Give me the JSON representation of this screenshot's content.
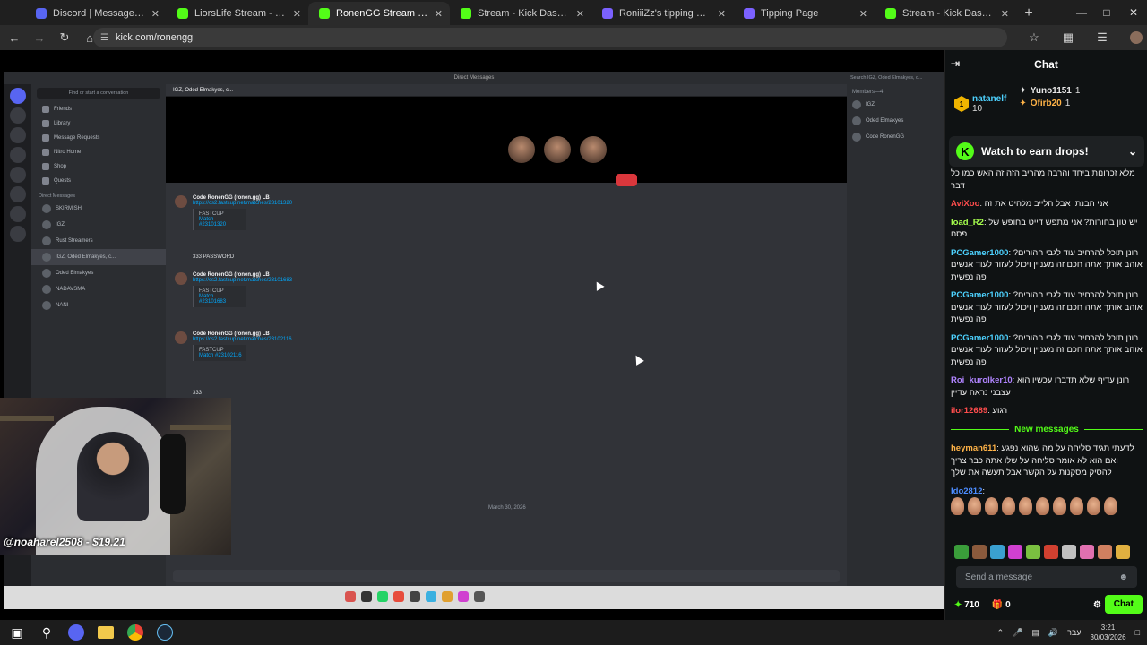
{
  "browser": {
    "tabs": [
      {
        "title": "Discord | Message Requests",
        "favicon_color": "#5865f2",
        "active": false
      },
      {
        "title": "LiorsLife Stream - Watch Live o",
        "favicon_color": "#53fc18",
        "active": false
      },
      {
        "title": "RonenGG Stream - Watch L",
        "favicon_color": "#53fc18",
        "active": true
      },
      {
        "title": "Stream - Kick Dashboard",
        "favicon_color": "#53fc18",
        "active": false
      },
      {
        "title": "RoniiiZz's tipping page",
        "favicon_color": "#7b61ff",
        "active": false
      },
      {
        "title": "Tipping Page",
        "favicon_color": "#7b61ff",
        "active": false
      },
      {
        "title": "Stream - Kick Dashboard",
        "favicon_color": "#53fc18",
        "active": false
      }
    ],
    "url": "kick.com/ronengg"
  },
  "stream": {
    "discord": {
      "title": "Direct Messages",
      "find_placeholder": "Find or start a conversation",
      "nav": [
        "Friends",
        "Library",
        "Message Requests",
        "Nitro Home",
        "Shop",
        "Quests"
      ],
      "dm_header": "Direct Messages",
      "dms": [
        "SKIRMISH",
        "IGZ",
        "Rust Streamers",
        "IGZ, Oded Elmakyes, c...",
        "Oded Elmakyes",
        "NADAVSMA",
        "NANI"
      ],
      "channel_title": "IGZ, Oded Elmakyes, c...",
      "search_placeholder": "Search IGZ, Oded Elmakyes, c...",
      "messages": [
        {
          "author": "Code RonenGG (ronen.gg) LB",
          "link": "https://cs2.fastcup.net/matches/23101320",
          "card_title": "FASTCUP",
          "card_link": "Match #23101320"
        },
        {
          "author": "",
          "text": "333 PASSWORD"
        },
        {
          "author": "Code RonenGG (ronen.gg) LB",
          "link": "https://cs2.fastcup.net/matches/23101683",
          "card_title": "FASTCUP",
          "card_link": "Match #23101683"
        },
        {
          "author": "Code RonenGG (ronen.gg) LB",
          "link": "https://cs2.fastcup.net/matches/23102116",
          "card_title": "FASTCUP",
          "card_link": "Match #23102116"
        },
        {
          "author": "",
          "text": "333"
        }
      ],
      "date_divider": "March 30, 2026",
      "members_label": "Members—4",
      "members": [
        "IGZ",
        "Oded Elmakyes",
        "Code RonenGG"
      ]
    },
    "donation_overlay": "@noaharel2508 - $19.21"
  },
  "chat": {
    "title": "Chat",
    "gifters": [
      {
        "name": "natanelf",
        "count": "10",
        "rank": "1"
      },
      {
        "name": "Yuno1151",
        "count": "1"
      },
      {
        "name": "Ofirb20",
        "count": "1"
      }
    ],
    "drops_label": "Watch to earn drops!",
    "messages": [
      {
        "user": "",
        "color": "#ffffff",
        "text": "מלא זכרונות ביחד והרבה מהריב הזה זה האש כמו כל דבר"
      },
      {
        "user": "AviXoo",
        "color": "#ff4d4d",
        "text": "אני הבנתי אבל הלייב מלהיט את זה"
      },
      {
        "user": "load_R2",
        "color": "#a6ff4d",
        "text": "יש טון בחורות? אני מתפש דייט בחופש של פסח"
      },
      {
        "user": "PCGamer1000",
        "color": "#4dd2ff",
        "text": "רונן תוכל להרחיב עוד לגבי ההורים? אוהב אותך אתה חכם זה מעניין ויכול לעזור לעוד אנשים פה נפשית"
      },
      {
        "user": "PCGamer1000",
        "color": "#4dd2ff",
        "text": "רונן תוכל להרחיב עוד לגבי ההורים? אוהב אותך אתה חכם זה מעניין ויכול לעזור לעוד אנשים פה נפשית"
      },
      {
        "user": "PCGamer1000",
        "color": "#4dd2ff",
        "text": "רונן תוכל להרחיב עוד לגבי ההורים? אוהב אותך אתה חכם זה מעניין ויכול לעזור לעוד אנשים פה נפשית"
      },
      {
        "user": "Roi_kurolker10",
        "color": "#b084ff",
        "text": "רונן עדיף שלא תדברו עכשיו הוא עצבני נראה עדיין"
      },
      {
        "user": "ilor12689",
        "color": "#ff4d4d",
        "text": "רגוע"
      }
    ],
    "new_messages_label": "New messages",
    "after_messages": [
      {
        "user": "heyman611",
        "color": "#ffb347",
        "text": "לדעתי תגיד סליחה על מה שהוא נפגע ואם הוא לא אומר סליחה על שלו אתה כבר צריך להסיק מסקנות על הקשר אבל תעשה את שלך"
      },
      {
        "user": "Ido2812",
        "color": "#4d8dff",
        "text": ""
      }
    ],
    "send_placeholder": "Send a message",
    "points": "710",
    "gifts": "0",
    "chat_button": "Chat"
  },
  "taskbar": {
    "time": "3:21",
    "date": "30/03/2026",
    "lang": "עבר"
  }
}
